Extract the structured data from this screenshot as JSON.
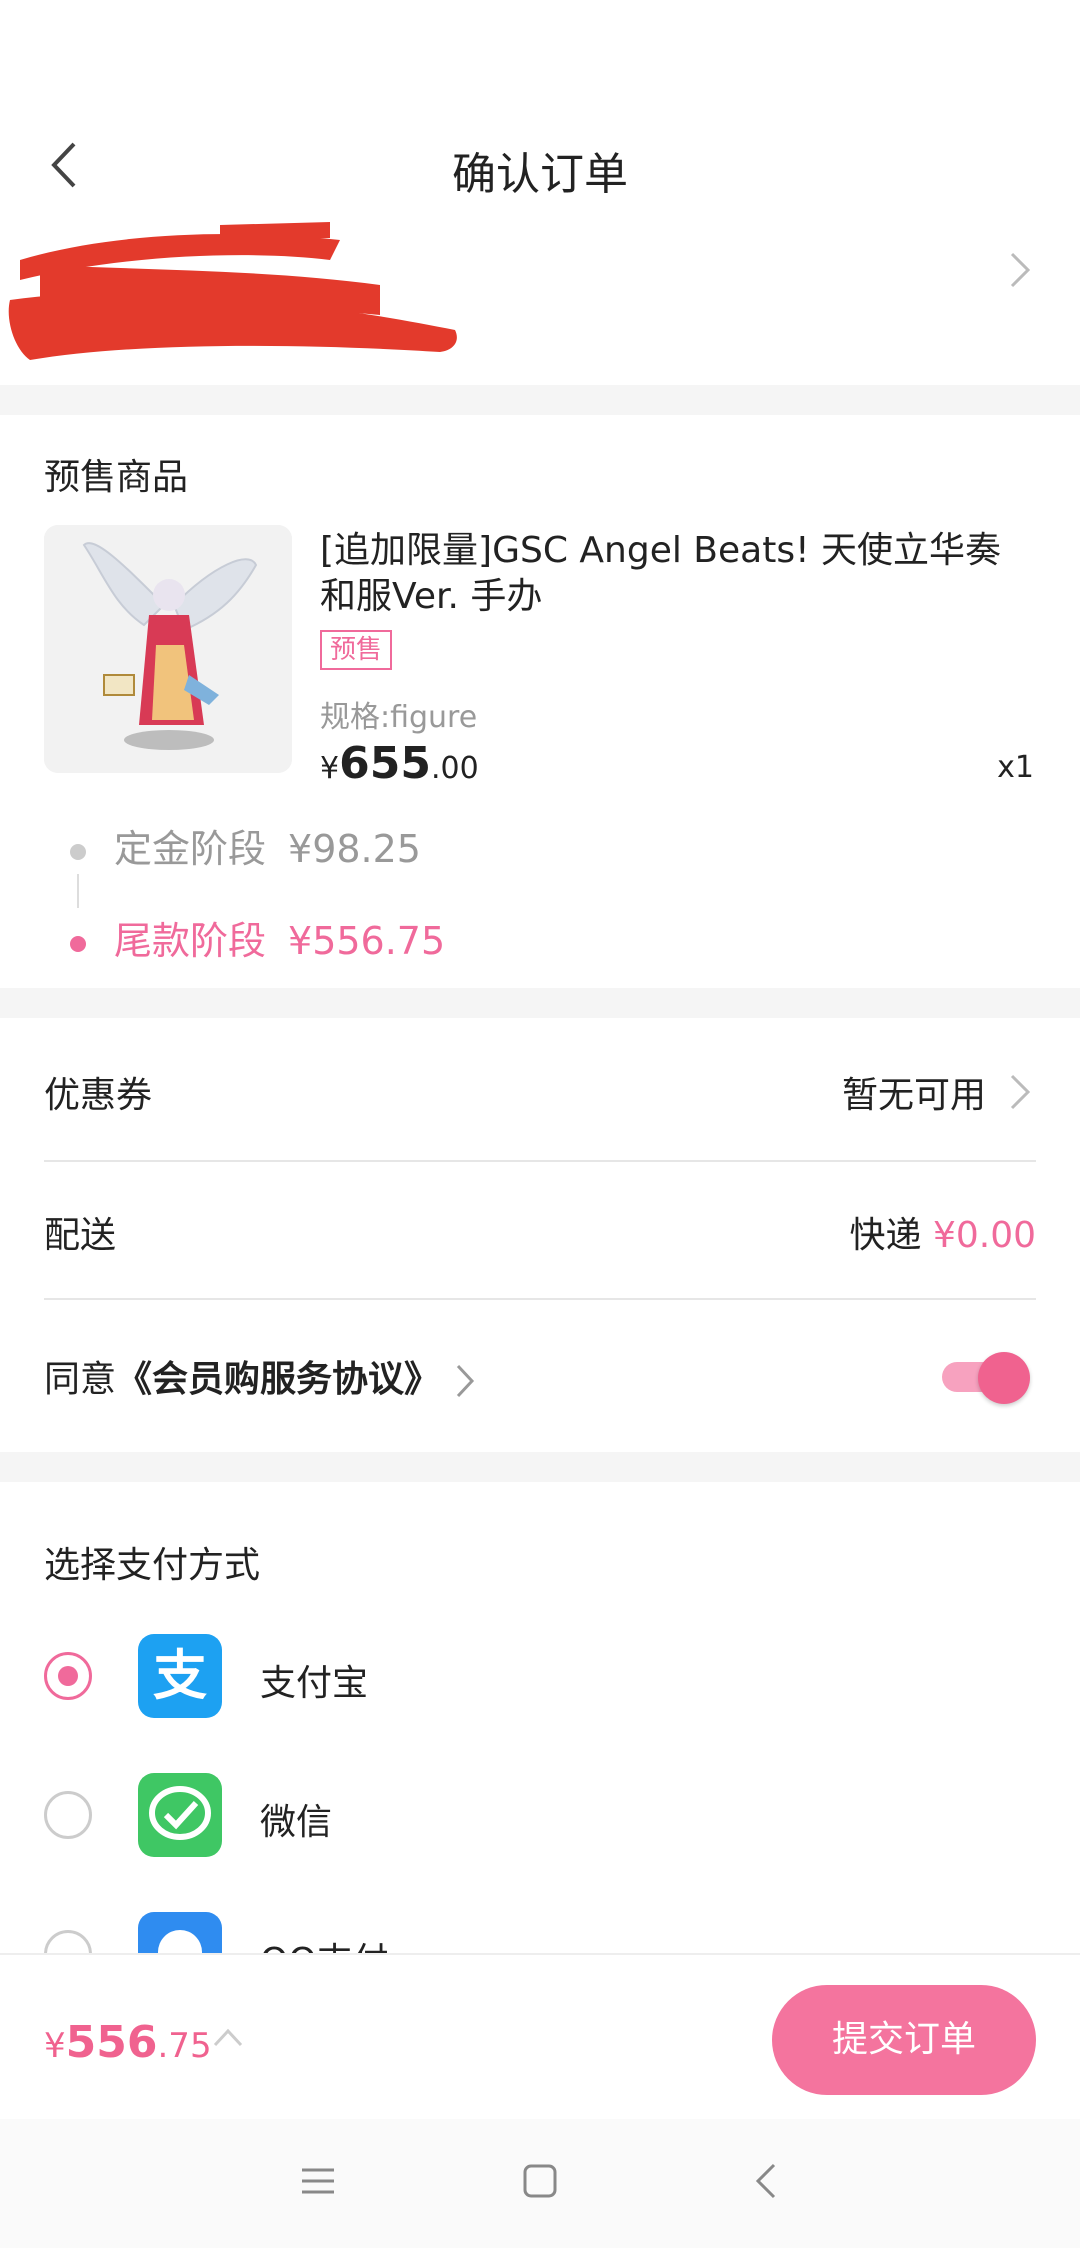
{
  "header": {
    "title": "确认订单"
  },
  "presale": {
    "section_title": "预售商品",
    "product": {
      "name": "[追加限量]GSC Angel Beats! 天使立华奏和服Ver. 手办",
      "tag": "预售",
      "spec": "规格:figure",
      "price_currency": "¥",
      "price_int": "655",
      "price_dec": ".00",
      "qty": "x1"
    },
    "stages": [
      {
        "label": "定金阶段",
        "amount": "¥98.25",
        "color": "#999999"
      },
      {
        "label": "尾款阶段",
        "amount": "¥556.75",
        "color": "#f06a9b"
      }
    ]
  },
  "coupon": {
    "label": "优惠券",
    "value": "暂无可用"
  },
  "delivery": {
    "label": "配送",
    "method": "快递",
    "fee": "¥0.00"
  },
  "agreement": {
    "prefix": "同意",
    "link": "《会员购服务协议》",
    "enabled": true
  },
  "payment": {
    "title": "选择支付方式",
    "methods": [
      {
        "label": "支付宝",
        "icon": "alipay-icon",
        "selected": true
      },
      {
        "label": "微信",
        "icon": "wechat-icon",
        "selected": false
      },
      {
        "label": "QQ支付",
        "icon": "qq-pay-icon",
        "selected": false
      }
    ]
  },
  "bottom": {
    "total_currency": "¥",
    "total_int": "556",
    "total_dec": ".75",
    "submit_label": "提交订单"
  },
  "colors": {
    "accent": "#f06a9b",
    "alipay": "#1da1f2",
    "wechat": "#3fc764"
  }
}
